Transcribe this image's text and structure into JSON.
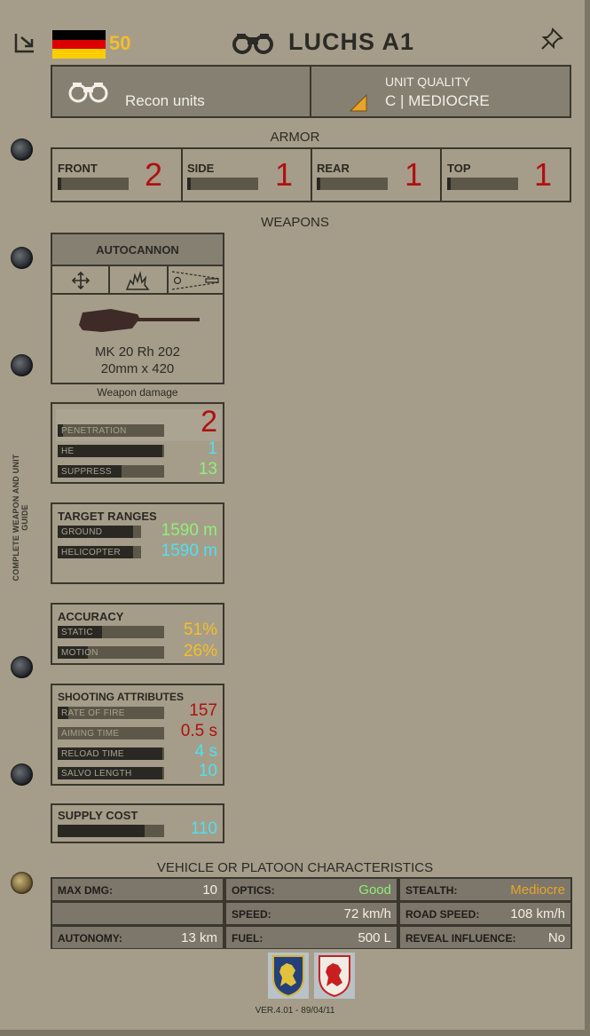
{
  "header": {
    "title": "LUCHS A1",
    "price": "50"
  },
  "unit": {
    "category": "Recon units",
    "quality_label": "UNIT QUALITY",
    "quality_value": "C | MEDIOCRE"
  },
  "armor": {
    "title": "ARMOR",
    "items": [
      {
        "label": "FRONT",
        "value": "2",
        "level": 0.05
      },
      {
        "label": "SIDE",
        "value": "1",
        "level": 0.05
      },
      {
        "label": "REAR",
        "value": "1",
        "level": 0.05
      },
      {
        "label": "TOP",
        "value": "1",
        "level": 0.05
      }
    ]
  },
  "weapons_title": "WEAPONS",
  "weapon": {
    "type": "AUTOCANNON",
    "name": "MK 20 Rh 202",
    "caliber": "20mm  x  420",
    "damage_label": "Weapon damage"
  },
  "damage": [
    {
      "label": "PENETRATION",
      "value": "2",
      "level": 0.05
    },
    {
      "label": "HE",
      "value": "1",
      "level": 0.98
    },
    {
      "label": "SUPPRESS",
      "value": "13",
      "level": 0.6
    }
  ],
  "ranges": {
    "title": "TARGET RANGES",
    "items": [
      {
        "label": "GROUND TARGET",
        "value": "1590 m",
        "level": 0.9
      },
      {
        "label": "HELICOPTER",
        "value": "1590 m",
        "level": 0.9
      }
    ]
  },
  "accuracy": {
    "title": "ACCURACY",
    "items": [
      {
        "label": "STATIC",
        "value": "51%",
        "level": 0.42
      },
      {
        "label": "MOTION",
        "value": "26%",
        "level": 0.28
      }
    ]
  },
  "shooting": {
    "title": "SHOOTING ATTRIBUTES",
    "items": [
      {
        "label": "RATE OF FIRE",
        "value": "157",
        "level": 0.1
      },
      {
        "label": "AIMING TIME",
        "value": "0.5 s",
        "level": 0.0
      },
      {
        "label": "RELOAD TIME",
        "value": "4 s",
        "level": 0.98
      },
      {
        "label": "SALVO LENGTH",
        "value": "10",
        "level": 0.98
      }
    ]
  },
  "supply": {
    "title": "SUPPLY COST",
    "value": "110",
    "level": 0.82
  },
  "vehicle": {
    "title": "VEHICLE OR PLATOON CHARACTERISTICS",
    "max_dmg_label": "MAX DMG:",
    "max_dmg": "10",
    "optics_label": "OPTICS:",
    "optics": "Good",
    "stealth_label": "STEALTH:",
    "stealth": "Mediocre",
    "speed_label": "SPEED:",
    "speed": "72 km/h",
    "road_speed_label": "ROAD SPEED:",
    "road_speed": "108 km/h",
    "autonomy_label": "AUTONOMY:",
    "autonomy": "13 km",
    "fuel_label": "FUEL:",
    "fuel": "500 L",
    "reveal_label": "REVEAL INFLUENCE:",
    "reveal": "No"
  },
  "side_text": "COMPLETE WEAPON AND UNIT GUIDE",
  "version": "VER.4.01 - 89/04/11"
}
